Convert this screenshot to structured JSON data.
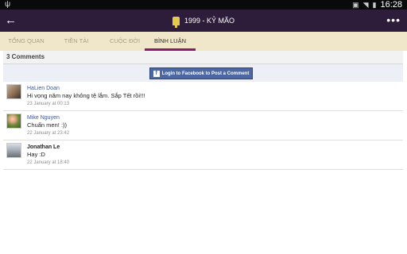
{
  "status_bar": {
    "left_icon": "usb-icon",
    "right_icons": [
      "screen-rotation-icon",
      "wifi-icon",
      "battery-icon"
    ],
    "time": "16:28"
  },
  "action_bar": {
    "back_icon": "arrow-left-icon",
    "title_icon": "fortune-stick-icon",
    "title": "1999 - KỶ MÃO",
    "overflow_icon": "more-vert-icon",
    "background": "#2d1d3a"
  },
  "tabs": [
    {
      "label": "TỔNG QUAN",
      "active": false
    },
    {
      "label": "TIỀN TÀI",
      "active": false
    },
    {
      "label": "CUỘC ĐỜI",
      "active": false
    },
    {
      "label": "BÌNH LUẬN",
      "active": true
    }
  ],
  "comments_section": {
    "count_label": "3 Comments",
    "login_button": "Login to Facebook to Post a Comment",
    "facebook_icon": "facebook-icon",
    "items": [
      {
        "name": "HaLien Doan",
        "text": "Hi vọng năm nay không tệ lắm. Sắp Tết rồi!!!",
        "date": "23 January at 00:13"
      },
      {
        "name": "Mike Nguyen",
        "text": "Chuẩn men! :))",
        "date": "22 January at 23:42"
      },
      {
        "name": "Jonathan Le",
        "text": "Hay :D",
        "date": "22 January at 18:40"
      }
    ]
  },
  "colors": {
    "tab_bar": "#f0e6c9",
    "tab_indicator": "#8a1a6c",
    "facebook_blue": "#4c67a1",
    "name_link": "#3b5998"
  }
}
